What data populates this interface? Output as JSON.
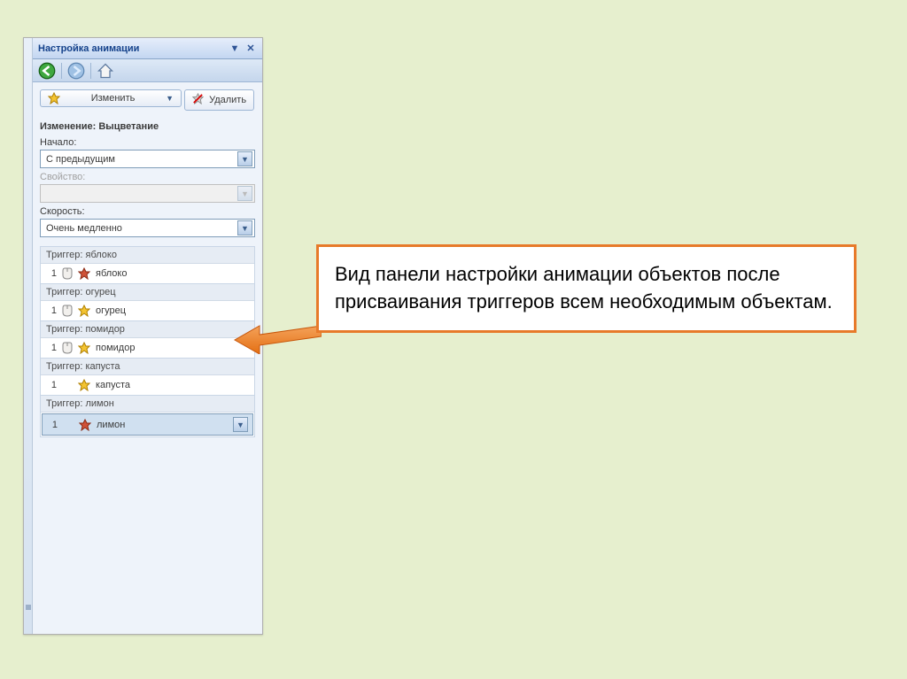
{
  "panel": {
    "title": "Настройка анимации",
    "change_btn": "Изменить",
    "remove_btn": "Удалить",
    "effect_section": "Изменение: Выцветание",
    "start_label": "Начало:",
    "start_value": "С предыдущим",
    "property_label": "Свойство:",
    "speed_label": "Скорость:",
    "speed_value": "Очень медленно",
    "triggers": [
      {
        "header": "Триггер: яблоко",
        "idx": "1",
        "name": "яблоко",
        "mouse": true,
        "dd": false,
        "effect": "red"
      },
      {
        "header": "Триггер: огурец",
        "idx": "1",
        "name": "огурец",
        "mouse": true,
        "dd": false,
        "effect": "gold"
      },
      {
        "header": "Триггер: помидор",
        "idx": "1",
        "name": "помидор",
        "mouse": true,
        "dd": false,
        "effect": "gold"
      },
      {
        "header": "Триггер: капуста",
        "idx": "1",
        "name": "капуста",
        "mouse": false,
        "dd": false,
        "effect": "gold"
      },
      {
        "header": "Триггер: лимон",
        "idx": "1",
        "name": "лимон",
        "mouse": false,
        "dd": true,
        "effect": "red",
        "selected": true
      }
    ]
  },
  "callout": "Вид панели настройки анимации объектов после присваивания триггеров всем необходимым объектам."
}
